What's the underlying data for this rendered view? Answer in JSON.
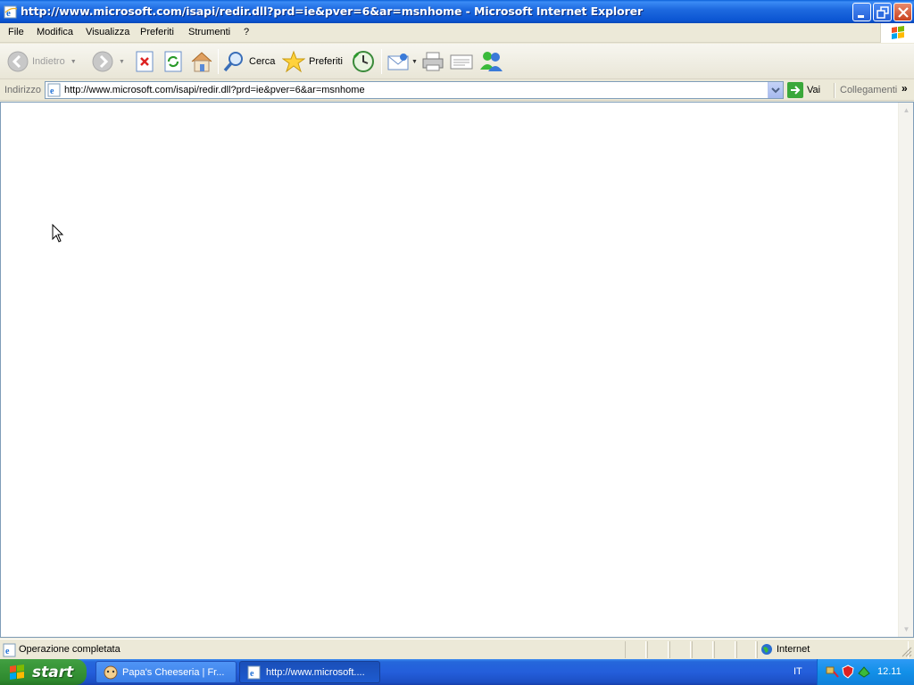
{
  "window": {
    "title": "http://www.microsoft.com/isapi/redir.dll?prd=ie&pver=6&ar=msnhome - Microsoft Internet Explorer"
  },
  "menu": [
    "File",
    "Modifica",
    "Visualizza",
    "Preferiti",
    "Strumenti",
    "?"
  ],
  "toolbar": {
    "back_label": "Indietro",
    "search_label": "Cerca",
    "favorites_label": "Preferiti"
  },
  "address": {
    "label": "Indirizzo",
    "url": "http://www.microsoft.com/isapi/redir.dll?prd=ie&pver=6&ar=msnhome",
    "go_label": "Vai",
    "links_label": "Collegamenti",
    "links_more": "»"
  },
  "status": {
    "text": "Operazione completata",
    "zone": "Internet"
  },
  "taskbar": {
    "start_label": "start",
    "tasks": [
      {
        "label": "Papa's Cheeseria | Fr..."
      },
      {
        "label": "http://www.microsoft...."
      }
    ],
    "language": "IT",
    "clock": "12.11"
  },
  "colors": {
    "titlebar": "#0B55D2",
    "taskbar": "#245EDB",
    "start_button": "#3C9A3C",
    "chrome": "#ECE9D8"
  }
}
